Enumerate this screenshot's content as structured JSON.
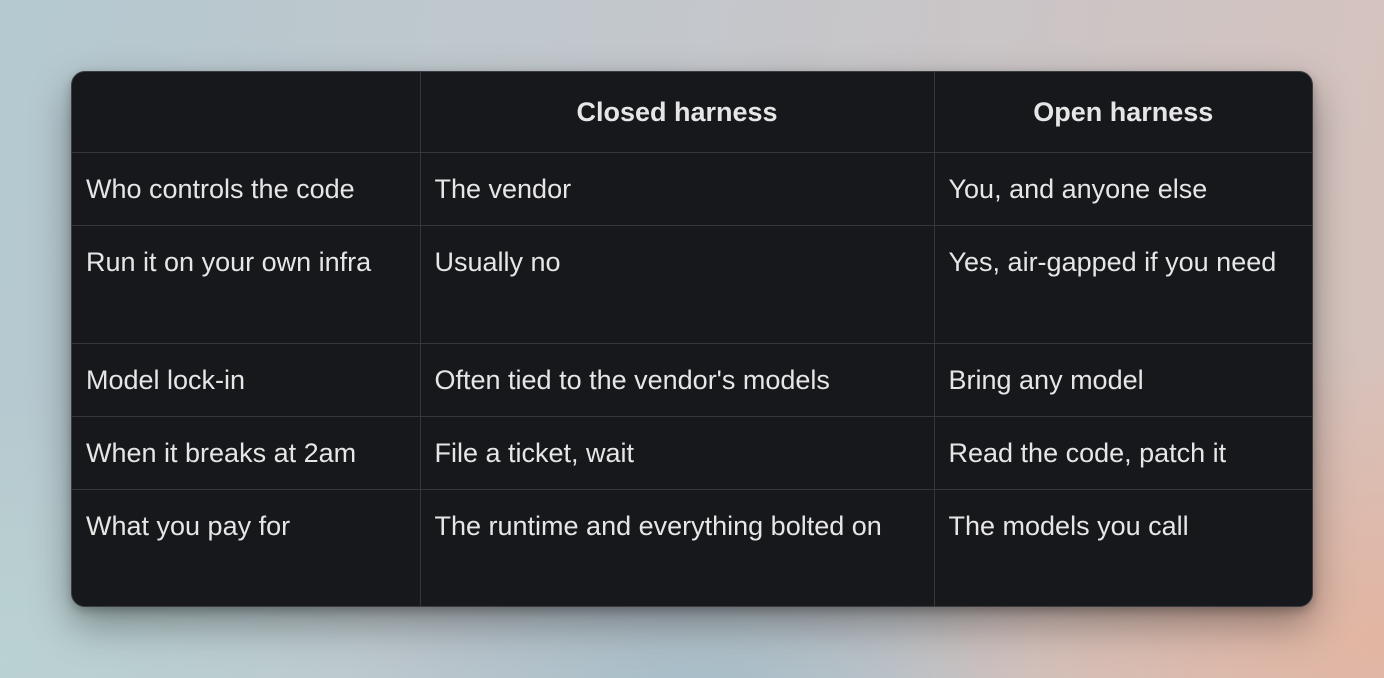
{
  "table": {
    "headers": [
      "",
      "Closed harness",
      "Open harness"
    ],
    "rows": [
      [
        "Who controls the code",
        "The vendor",
        "You, and anyone else"
      ],
      [
        "Run it on your own infra",
        "Usually no",
        "Yes, air-gapped if you need"
      ],
      [
        "Model lock-in",
        "Often tied to the vendor's models",
        "Bring any model"
      ],
      [
        "When it breaks at 2am",
        "File a ticket, wait",
        "Read the code, patch it"
      ],
      [
        "What you pay for",
        "The runtime and everything bolted on",
        "The models you call"
      ]
    ]
  }
}
